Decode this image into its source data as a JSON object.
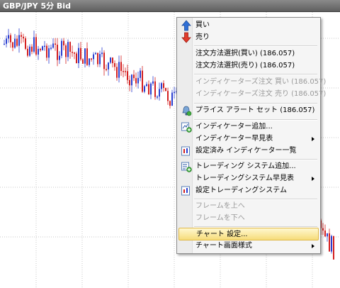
{
  "window": {
    "title": "GBP/JPY 5分 Bid"
  },
  "context_menu": {
    "items": [
      {
        "label": "買い",
        "icon": "arrow-up-icon"
      },
      {
        "label": "売り",
        "icon": "arrow-down-icon"
      },
      {
        "label": "注文方法選択(買い) (186.057)"
      },
      {
        "label": "注文方法選択(売り) (186.057)"
      },
      {
        "label": "インディケーターズ注文 買い (186.057)",
        "disabled": true
      },
      {
        "label": "インディケーターズ注文 売り (186.057)",
        "disabled": true
      },
      {
        "label": "プライス アラート セット (186.057)",
        "icon": "alert-bell-icon"
      },
      {
        "label": "インディケーター追加...",
        "icon": "add-indicator-icon"
      },
      {
        "label": "インディケーター早見表",
        "submenu": true
      },
      {
        "label": "設定済み インディケーター一覧",
        "icon": "indicator-list-icon"
      },
      {
        "label": "トレーディング システム追加...",
        "icon": "add-system-icon"
      },
      {
        "label": "トレーディングシステム早見表",
        "submenu": true
      },
      {
        "label": "設定トレーディングシステム",
        "icon": "system-list-icon"
      },
      {
        "label": "フレームを上へ",
        "disabled": true
      },
      {
        "label": "フレームを下へ",
        "disabled": true
      },
      {
        "label": "チャート 設定...",
        "highlighted": true
      },
      {
        "label": "チャート画面様式",
        "submenu": true
      }
    ]
  },
  "colors": {
    "bull_candle": "#2a3fd0",
    "bear_candle": "#d42020",
    "menu_highlight": "#f6dc7a"
  }
}
